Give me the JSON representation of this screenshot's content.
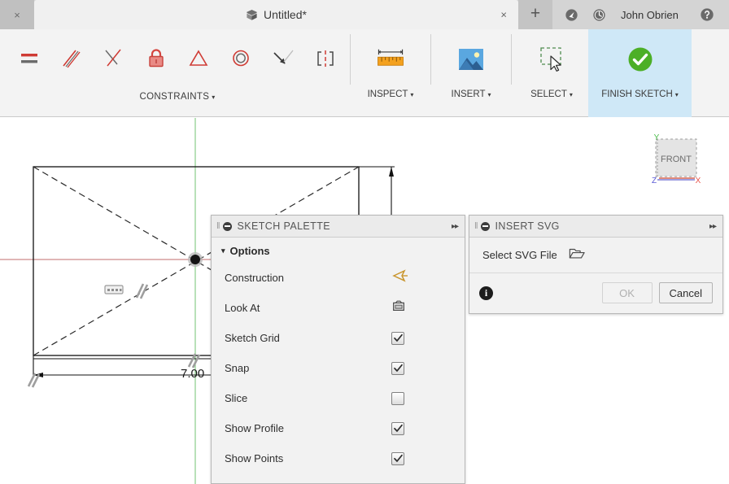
{
  "window": {
    "tab_prev_label": "×",
    "document_title": "Untitled*",
    "doc_icon": "document-icon",
    "tab_close_label": "×",
    "new_tab_label": "+",
    "user_name": "John Obrien",
    "icons": {
      "refresh": "refresh-icon",
      "history": "history-icon",
      "help": "help-icon"
    }
  },
  "ribbon": {
    "groups": [
      {
        "name": "constraints",
        "label": "CONSTRAINTS",
        "caret": "▾",
        "buttons": [
          {
            "name": "horizontal-vertical-constraint",
            "tooltip": "Horizontal/Vertical"
          },
          {
            "name": "parallel-constraint",
            "tooltip": "Parallel"
          },
          {
            "name": "perpendicular-constraint",
            "tooltip": "Perpendicular"
          },
          {
            "name": "fix-unfix-constraint",
            "tooltip": "Fix/UnFix"
          },
          {
            "name": "equal-constraint",
            "tooltip": "Equal"
          },
          {
            "name": "concentric-constraint",
            "tooltip": "Concentric"
          },
          {
            "name": "collinear-constraint",
            "tooltip": "Collinear"
          },
          {
            "name": "symmetry-constraint",
            "tooltip": "Symmetry"
          }
        ]
      }
    ],
    "commands": [
      {
        "name": "inspect",
        "label": "INSPECT",
        "caret": "▾",
        "icon": "ruler-icon",
        "active": false
      },
      {
        "name": "insert",
        "label": "INSERT",
        "caret": "▾",
        "icon": "image-icon",
        "active": false
      },
      {
        "name": "select",
        "label": "SELECT",
        "caret": "▾",
        "icon": "marquee-cursor-icon",
        "active": false
      },
      {
        "name": "finish-sketch",
        "label": "FINISH SKETCH",
        "caret": "▾",
        "icon": "green-check-icon",
        "active": true
      }
    ]
  },
  "canvas": {
    "dimension_value": "7.00",
    "viewcube": {
      "face_label": "FRONT",
      "axis_x": "X",
      "axis_y": "Y",
      "axis_z": "Z",
      "color_x": "#e8544a",
      "color_y": "#5fbf5f",
      "color_z": "#5a5ad6"
    },
    "axis_color_horizontal": "#c06c6c",
    "axis_color_vertical": "#7dc87d"
  },
  "sketch_palette": {
    "grip": "‖",
    "title": "SKETCH PALETTE",
    "expand": "▸▸",
    "section_title": "Options",
    "section_caret": "▾",
    "options": [
      {
        "name": "construction",
        "label": "Construction",
        "control": "icon",
        "icon": "construction-icon",
        "checked": null
      },
      {
        "name": "look-at",
        "label": "Look At",
        "control": "icon",
        "icon": "look-at-icon",
        "checked": null
      },
      {
        "name": "sketch-grid",
        "label": "Sketch Grid",
        "control": "checkbox",
        "icon": null,
        "checked": true
      },
      {
        "name": "snap",
        "label": "Snap",
        "control": "checkbox",
        "icon": null,
        "checked": true
      },
      {
        "name": "slice",
        "label": "Slice",
        "control": "checkbox",
        "icon": null,
        "checked": false
      },
      {
        "name": "show-profile",
        "label": "Show Profile",
        "control": "checkbox",
        "icon": null,
        "checked": true
      },
      {
        "name": "show-points",
        "label": "Show Points",
        "control": "checkbox",
        "icon": null,
        "checked": true
      }
    ]
  },
  "insert_svg": {
    "grip": "‖",
    "title": "INSERT SVG",
    "expand": "▸▸",
    "file_row_label": "Select SVG File",
    "folder_icon": "folder-open-icon",
    "info_icon": "info-icon",
    "info_glyph": "i",
    "ok_label": "OK",
    "ok_enabled": false,
    "cancel_label": "Cancel"
  },
  "colors": {
    "accent_blue": "#cfe8f7",
    "constraint_red": "#d4453f",
    "green_check": "#4caf27",
    "tabbar_bg": "#d4d4d4",
    "ribbon_bg": "#f3f3f3"
  }
}
